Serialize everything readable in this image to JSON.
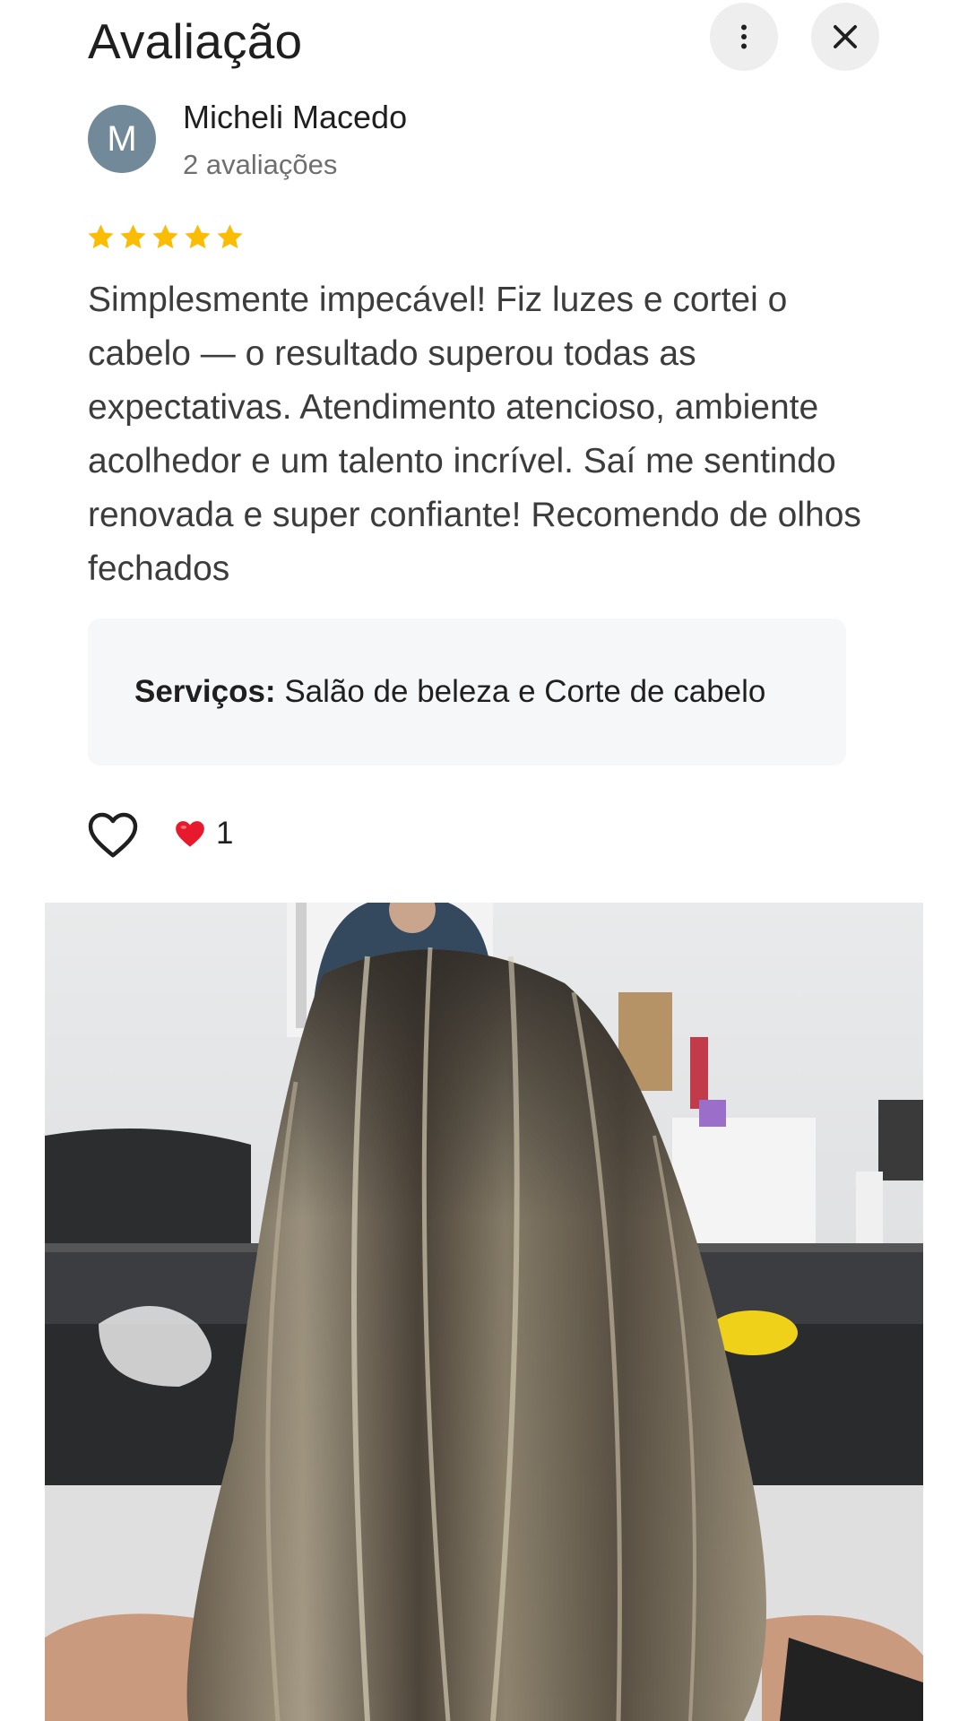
{
  "header": {
    "title": "Avaliação",
    "more_icon": "more-vert-icon",
    "close_icon": "close-icon"
  },
  "author": {
    "initial": "M",
    "name": "Micheli Macedo",
    "meta": "2 avaliações",
    "avatar_color": "#72899a"
  },
  "rating": {
    "stars": 5,
    "max": 5,
    "color": "#fbbc04"
  },
  "review": {
    "text": "Simplesmente impecável! Fiz luzes e cortei o cabelo — o resultado superou todas as expectativas. Atendimento atencioso, ambiente acolhedor e um talento incrível. Saí me sentindo renovada e super confiante! Recomendo de olhos fechados"
  },
  "services": {
    "label": "Serviços:",
    "value": " Salão de beleza e Corte de cabelo"
  },
  "reactions": {
    "like_icon": "heart-outline-icon",
    "reaction_icon": "red-heart-icon",
    "count": "1"
  },
  "photo": {
    "icon": "review-photo"
  }
}
